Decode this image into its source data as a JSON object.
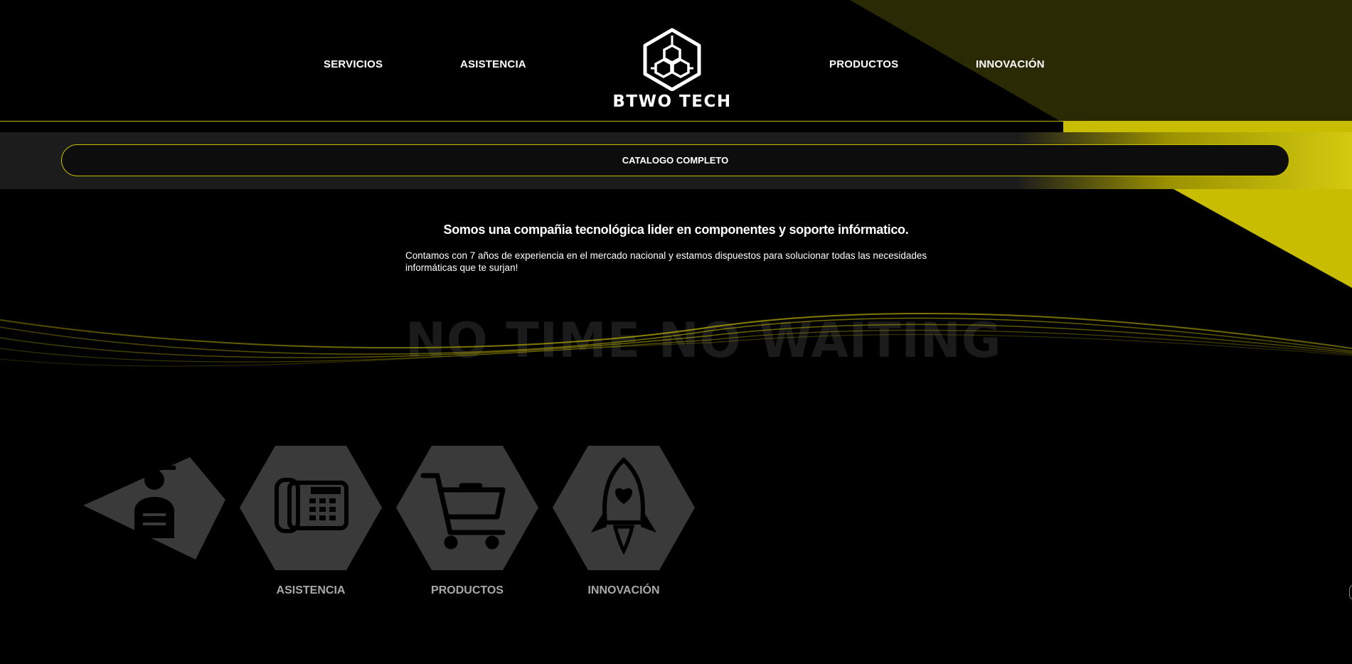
{
  "colors": {
    "accent": "#c8bd00",
    "background": "#000000",
    "band": "#1c1c1c",
    "hex_card": "#3a3a3a"
  },
  "nav": {
    "links": [
      {
        "label": "SERVICIOS"
      },
      {
        "label": "ASISTENCIA"
      },
      {
        "label": "PRODUCTOS"
      },
      {
        "label": "INNOVACIÓN"
      }
    ],
    "logo_text": "BTWO TECH",
    "logo_icon": "hexagon-circuit-logo-icon"
  },
  "catalog": {
    "label": "CATALOGO COMPLETO"
  },
  "hero": {
    "headline": "Somos una compañia tecnológica lider en componentes y soporte infórmatico.",
    "description": "Contamos con 7 años de experiencia en el mercado nacional y estamos dispuestos para solucionar todas las necesidades informáticas que te surjan!"
  },
  "tagline": {
    "text": "NO TIME NO WAITING"
  },
  "services": [
    {
      "label": "",
      "icon": "worker-icon"
    },
    {
      "label": "ASISTENCIA",
      "icon": "telephone-icon"
    },
    {
      "label": "PRODUCTOS",
      "icon": "shopping-cart-icon"
    },
    {
      "label": "INNOVACIÓN",
      "icon": "rocket-icon"
    }
  ]
}
